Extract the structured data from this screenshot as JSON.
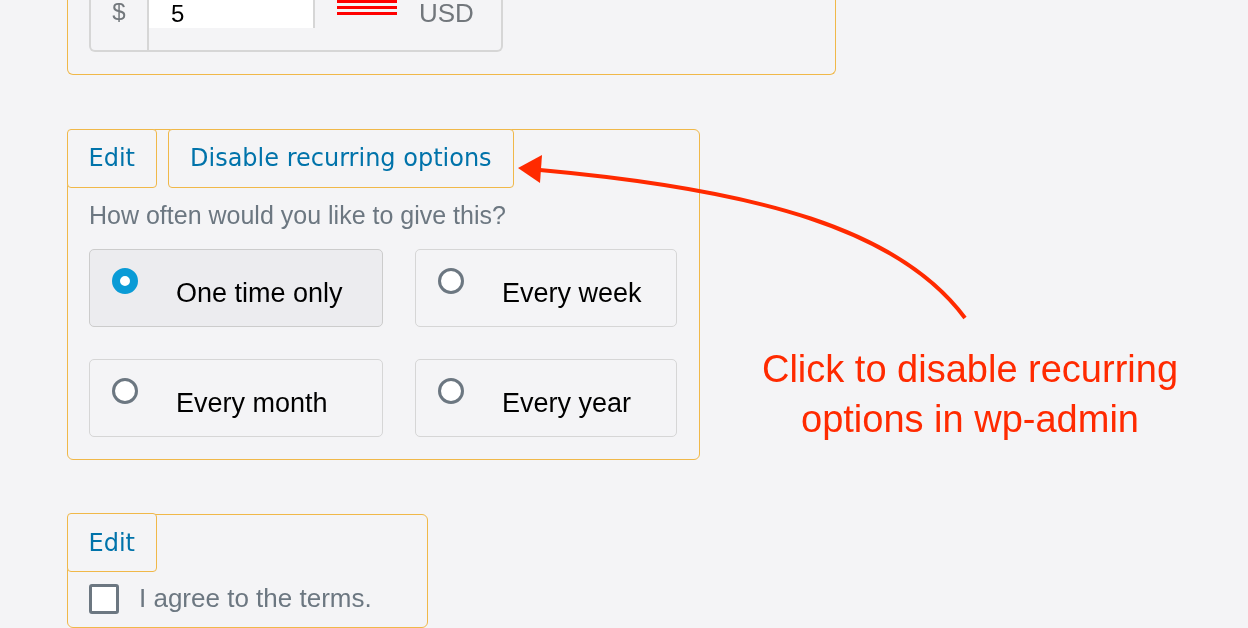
{
  "amount": {
    "currency_symbol": "$",
    "value": "5",
    "currency": "USD"
  },
  "frequency_block": {
    "actions": [
      {
        "label": "Edit"
      },
      {
        "label": "Disable recurring options"
      }
    ],
    "question": "How often would you like to give this?",
    "options": [
      {
        "label": "One time only",
        "selected": true
      },
      {
        "label": "Every week",
        "selected": false
      },
      {
        "label": "Every month",
        "selected": false
      },
      {
        "label": "Every year",
        "selected": false
      }
    ]
  },
  "terms_block": {
    "actions": [
      {
        "label": "Edit"
      }
    ],
    "checkbox": {
      "label": "I agree to the terms.",
      "checked": false
    }
  },
  "annotation": {
    "text": "Click to disable recurring options in wp-admin"
  }
}
